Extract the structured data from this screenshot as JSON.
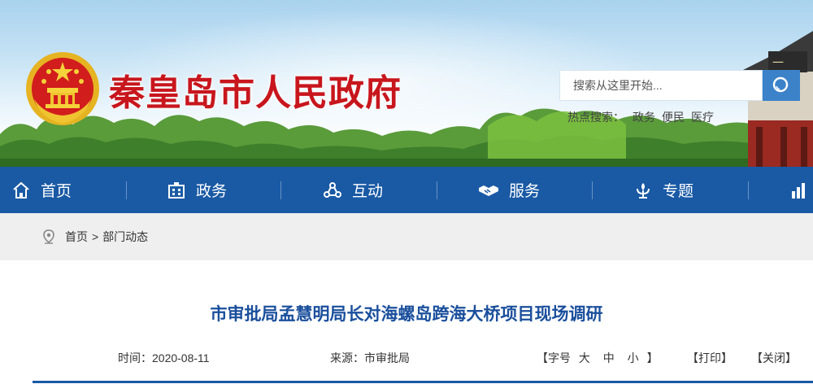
{
  "header": {
    "site_title": "秦皇岛市人民政府",
    "search_placeholder": "搜索从这里开始...",
    "hot_search_label": "热点搜索：",
    "hot_search_items": [
      "政务",
      "便民",
      "医疗"
    ]
  },
  "nav": {
    "items": [
      {
        "label": "首页",
        "icon": "home-icon"
      },
      {
        "label": "政务",
        "icon": "building-icon"
      },
      {
        "label": "互动",
        "icon": "interaction-icon"
      },
      {
        "label": "服务",
        "icon": "handshake-icon"
      },
      {
        "label": "专题",
        "icon": "special-topic-icon"
      }
    ],
    "partial_icon": "bar-chart-icon"
  },
  "breadcrumb": {
    "home": "首页",
    "separator": ">",
    "current": "部门动态"
  },
  "article": {
    "title": "市审批局孟慧明局长对海螺岛跨海大桥项目现场调研",
    "time": "时间：2020-08-11",
    "source": "来源：市审批局",
    "font_size_open": "【字号",
    "font_large": "大",
    "font_medium": "中",
    "font_small": "小",
    "font_size_close": "】",
    "print": "【打印】",
    "close": "【关闭】"
  },
  "colors": {
    "nav_bg": "#1a5aa5",
    "title_red": "#c8161d",
    "article_title_blue": "#1a4f9c",
    "search_button": "#3b82c9",
    "breadcrumb_bg": "#efefef"
  }
}
